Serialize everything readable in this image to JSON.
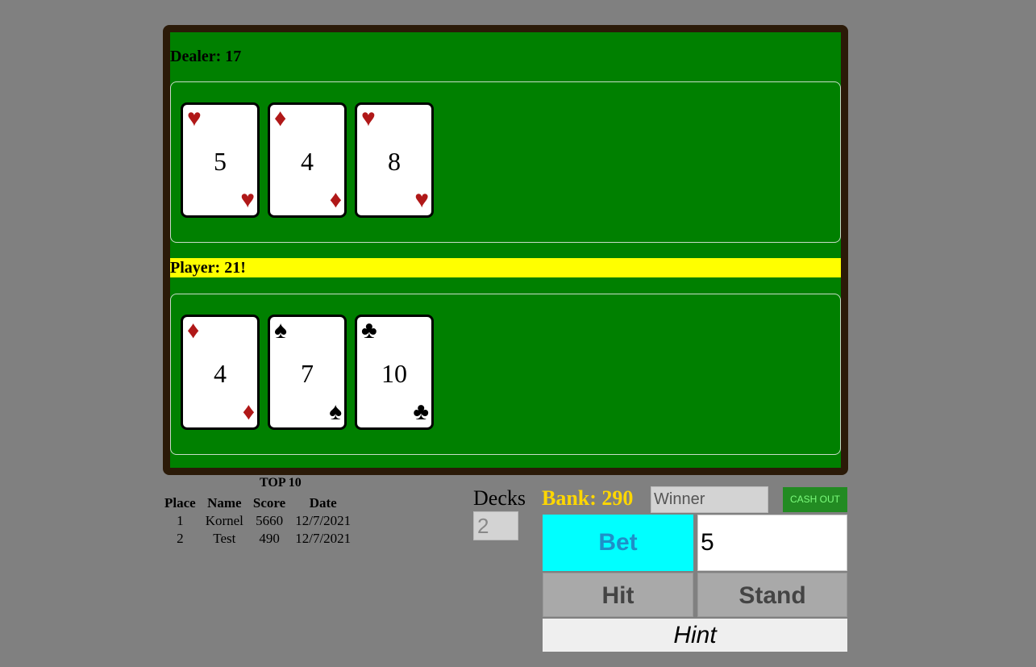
{
  "dealer": {
    "label": "Dealer: 17",
    "cards": [
      {
        "rank": "5",
        "suit": "♥",
        "color": "red"
      },
      {
        "rank": "4",
        "suit": "♦",
        "color": "red"
      },
      {
        "rank": "8",
        "suit": "♥",
        "color": "red"
      }
    ]
  },
  "player": {
    "label": "Player: 21!",
    "cards": [
      {
        "rank": "4",
        "suit": "♦",
        "color": "red"
      },
      {
        "rank": "7",
        "suit": "♠",
        "color": "black"
      },
      {
        "rank": "10",
        "suit": "♣",
        "color": "black"
      }
    ]
  },
  "leaderboard": {
    "title": "TOP 10",
    "headers": [
      "Place",
      "Name",
      "Score",
      "Date"
    ],
    "rows": [
      [
        "1",
        "Kornel",
        "5660",
        "12/7/2021"
      ],
      [
        "2",
        "Test",
        "490",
        "12/7/2021"
      ]
    ]
  },
  "decks": {
    "label": "Decks",
    "value": "2"
  },
  "bank": {
    "label": "Bank: 290"
  },
  "status": {
    "value": "Winner"
  },
  "controls": {
    "cash_out": "CASH OUT",
    "bet": "Bet",
    "bet_amount": "5",
    "hit": "Hit",
    "stand": "Stand",
    "hint": "Hint"
  },
  "colors": {
    "felt": "#008000",
    "table_rim": "#2b1a08",
    "player_highlight": "#ffff00",
    "bank": "#ffd700",
    "bet_button": "#00ffff",
    "cash_out": "#228b22"
  }
}
